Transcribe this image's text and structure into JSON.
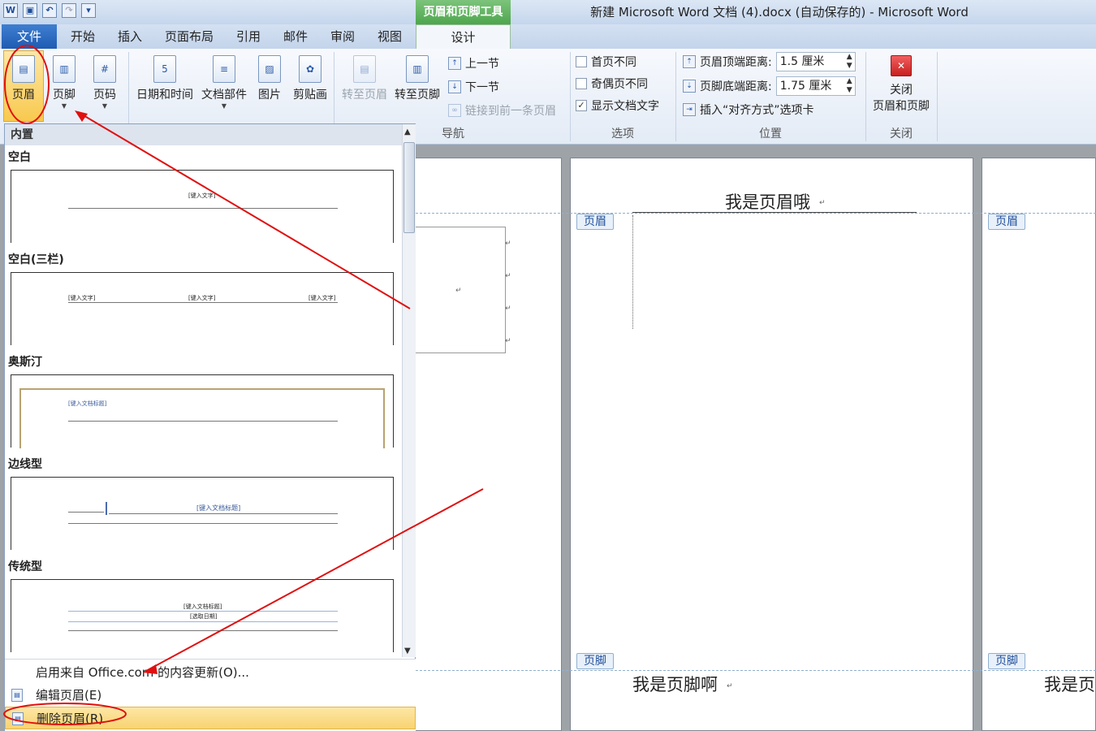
{
  "titlebar": {
    "app_icon": "W",
    "context_tab": "页眉和页脚工具",
    "title": "新建 Microsoft Word 文档 (4).docx (自动保存的) - Microsoft Word"
  },
  "tabs": [
    "文件",
    "开始",
    "插入",
    "页面布局",
    "引用",
    "邮件",
    "审阅",
    "视图",
    "设计"
  ],
  "ribbon": {
    "header_btn": "页眉",
    "footer_btn": "页脚",
    "pagenum_btn": "页码",
    "datetime_btn": "日期和时间",
    "docparts_btn": "文档部件",
    "picture_btn": "图片",
    "clipart_btn": "剪贴画",
    "goto_header": "转至页眉",
    "goto_footer": "转至页脚",
    "prev_section": "上一节",
    "next_section": "下一节",
    "link_prev": "链接到前一条页眉",
    "nav_label": "导航",
    "diff_first": "首页不同",
    "diff_oddeven": "奇偶页不同",
    "show_doc_text": "显示文档文字",
    "options_label": "选项",
    "header_top_label": "页眉顶端距离:",
    "header_top_value": "1.5 厘米",
    "footer_bottom_label": "页脚底端距离:",
    "footer_bottom_value": "1.75 厘米",
    "insert_align_tab": "插入“对齐方式”选项卡",
    "position_label": "位置",
    "close_line1": "关闭",
    "close_line2": "页眉和页脚",
    "close_label": "关闭",
    "show_doc_text_checked": true,
    "diff_first_checked": false,
    "diff_oddeven_checked": false
  },
  "gallery": {
    "heading": "内置",
    "sections": [
      {
        "name": "空白",
        "texts": [
          "[键入文字]"
        ]
      },
      {
        "name": "空白(三栏)",
        "texts": [
          "[键入文字]",
          "[键入文字]",
          "[键入文字]"
        ]
      },
      {
        "name": "奥斯汀",
        "texts": [
          "[键入文档标题]"
        ]
      },
      {
        "name": "边线型",
        "texts": [
          "[键入文档标题]"
        ]
      },
      {
        "name": "传统型",
        "texts": [
          "[键入文档标题]",
          "[选取日期]"
        ]
      }
    ],
    "menu": {
      "update": "启用来自 Office.com 的内容更新(O)...",
      "edit": "编辑页眉(E)",
      "delete": "删除页眉(R)"
    }
  },
  "document": {
    "header_tag": "页眉",
    "footer_tag": "页脚",
    "header_text": "我是页眉哦",
    "footer_text": "我是页脚啊",
    "footer_text_partial": "我是页"
  },
  "colors": {
    "annotation": "#e01010",
    "active_highlight": "#f8c94e",
    "design_context": "#4ea64e"
  }
}
